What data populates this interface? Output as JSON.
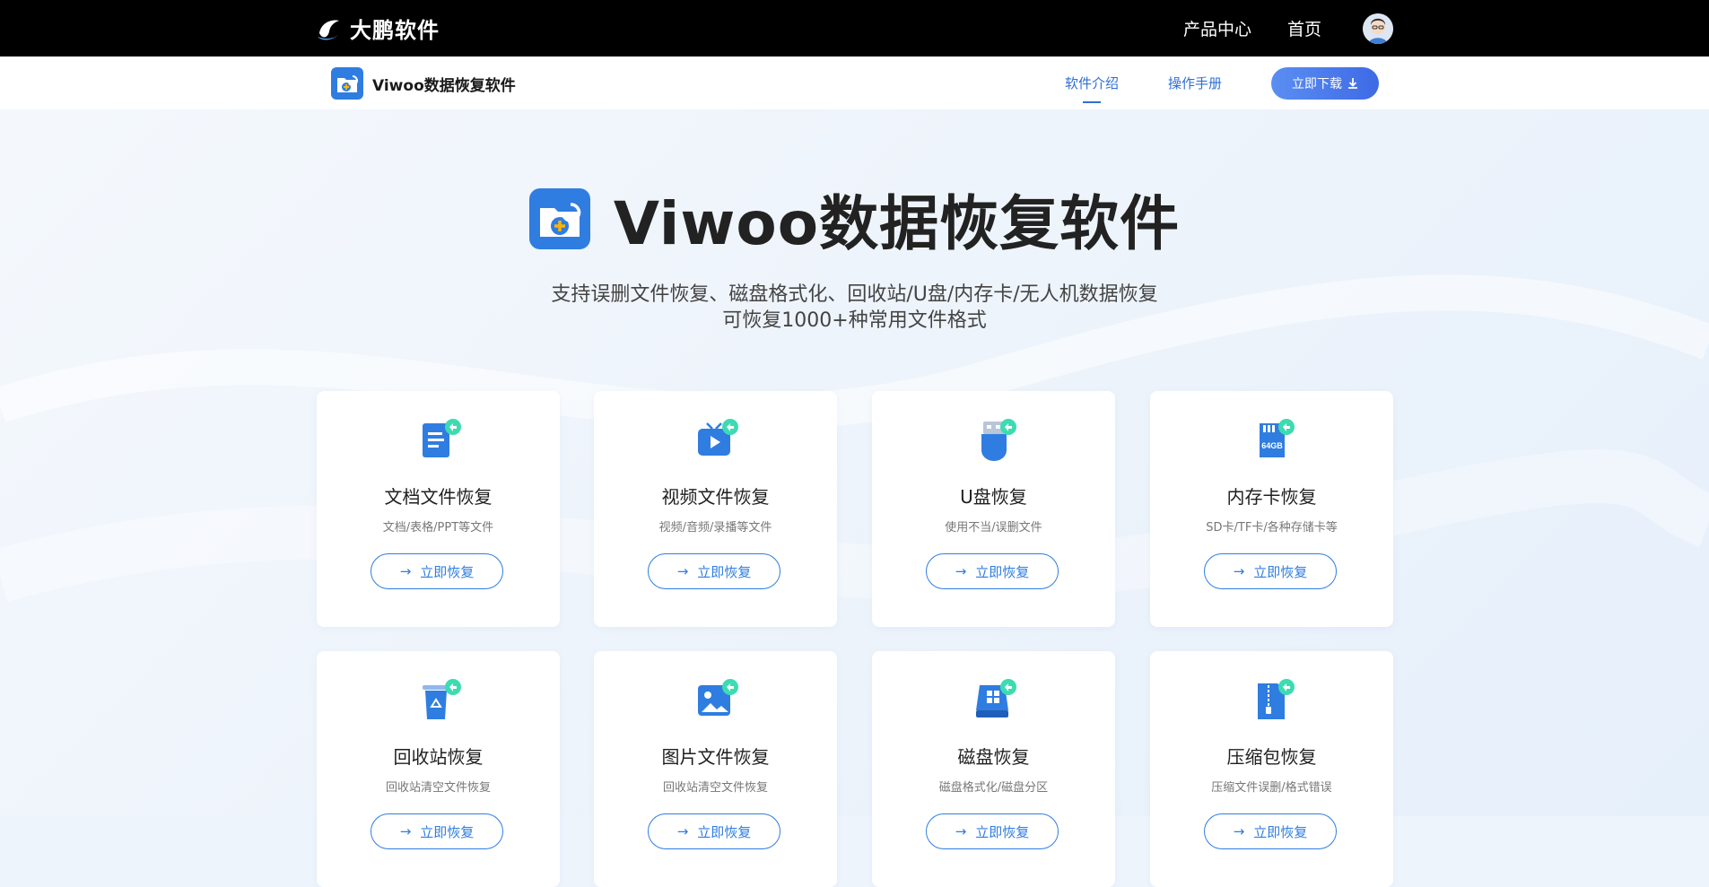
{
  "topbar": {
    "brand_name": "大鹏软件",
    "nav": [
      "产品中心",
      "首页"
    ]
  },
  "subbar": {
    "title": "Viwoo数据恢复软件",
    "nav": [
      "软件介绍",
      "操作手册"
    ],
    "download_label": "立即下载"
  },
  "hero": {
    "title": "Viwoo数据恢复软件",
    "line1": "支持误删文件恢复、磁盘格式化、回收站/U盘/内存卡/无人机数据恢复",
    "line2": "可恢复1000+种常用文件格式"
  },
  "cards": [
    {
      "title": "文档文件恢复",
      "desc": "文档/表格/PPT等文件",
      "button": "立即恢复",
      "icon": "document-icon"
    },
    {
      "title": "视频文件恢复",
      "desc": "视频/音频/录播等文件",
      "button": "立即恢复",
      "icon": "video-icon"
    },
    {
      "title": "U盘恢复",
      "desc": "使用不当/误删文件",
      "button": "立即恢复",
      "icon": "usb-icon"
    },
    {
      "title": "内存卡恢复",
      "desc": "SD卡/TF卡/各种存储卡等",
      "button": "立即恢复",
      "icon": "sdcard-icon",
      "icon_text": "64GB"
    },
    {
      "title": "回收站恢复",
      "desc": "回收站清空文件恢复",
      "button": "立即恢复",
      "icon": "recycle-bin-icon"
    },
    {
      "title": "图片文件恢复",
      "desc": "回收站清空文件恢复",
      "button": "立即恢复",
      "icon": "image-icon"
    },
    {
      "title": "磁盘恢复",
      "desc": "磁盘格式化/磁盘分区",
      "button": "立即恢复",
      "icon": "disk-icon"
    },
    {
      "title": "压缩包恢复",
      "desc": "压缩文件误删/格式错误",
      "button": "立即恢复",
      "icon": "zip-icon"
    }
  ],
  "colors": {
    "accent": "#2f7de1",
    "topbar_bg": "#000000",
    "badge_green": "#3ddbb2"
  }
}
